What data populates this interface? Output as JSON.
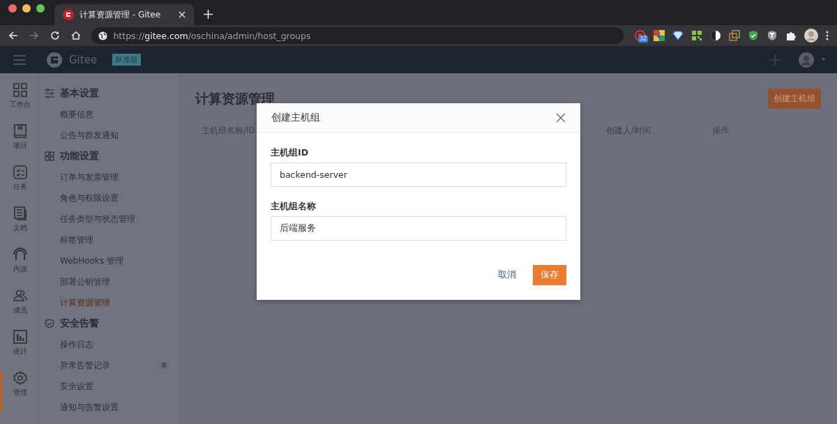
{
  "browser": {
    "tab": {
      "title": "计算资源管理 - Gitee",
      "selected": true
    },
    "url": {
      "scheme": "https://",
      "host": "gitee.com",
      "path": "/oschina/admin/host_groups"
    },
    "extension_badge": "32"
  },
  "app_header": {
    "brand": "Gitee",
    "edition": "标准版"
  },
  "nav_rail": [
    {
      "label": "工作台",
      "selected": false
    },
    {
      "label": "项目",
      "selected": false
    },
    {
      "label": "任务",
      "selected": false
    },
    {
      "label": "文档",
      "selected": false
    },
    {
      "label": "内源",
      "selected": false
    },
    {
      "label": "成员",
      "selected": false
    },
    {
      "label": "统计",
      "selected": false
    },
    {
      "label": "管理",
      "selected": true
    }
  ],
  "settings_menu": [
    {
      "title": "基本设置",
      "items": [
        {
          "label": "概要信息",
          "selected": false
        },
        {
          "label": "公告与群发通知",
          "selected": false
        }
      ]
    },
    {
      "title": "功能设置",
      "items": [
        {
          "label": "订单与发票管理",
          "selected": false
        },
        {
          "label": "角色与权限设置",
          "selected": false
        },
        {
          "label": "任务类型与状态管理",
          "selected": false
        },
        {
          "label": "标签管理",
          "selected": false
        },
        {
          "label": "WebHooks 管理",
          "selected": false
        },
        {
          "label": "部署公钥管理",
          "selected": false
        },
        {
          "label": "计算资源管理",
          "selected": true
        }
      ]
    },
    {
      "title": "安全告警",
      "items": [
        {
          "label": "操作日志",
          "selected": false
        },
        {
          "label": "异常告警记录",
          "selected": false,
          "badge": "0"
        },
        {
          "label": "安全设置",
          "selected": false
        },
        {
          "label": "通知与告警设置",
          "selected": false
        }
      ]
    }
  ],
  "page": {
    "title": "计算资源管理",
    "create_button": "创建主机组",
    "table": {
      "columns": [
        "主机组名称/ID",
        "创建人/时间",
        "操作"
      ]
    }
  },
  "dialog": {
    "title": "创建主机组",
    "fields": [
      {
        "label": "主机组ID",
        "value": "backend-server"
      },
      {
        "label": "主机组名称",
        "value": "后端服务"
      }
    ],
    "cancel_button": "取消",
    "save_button": "保存"
  }
}
